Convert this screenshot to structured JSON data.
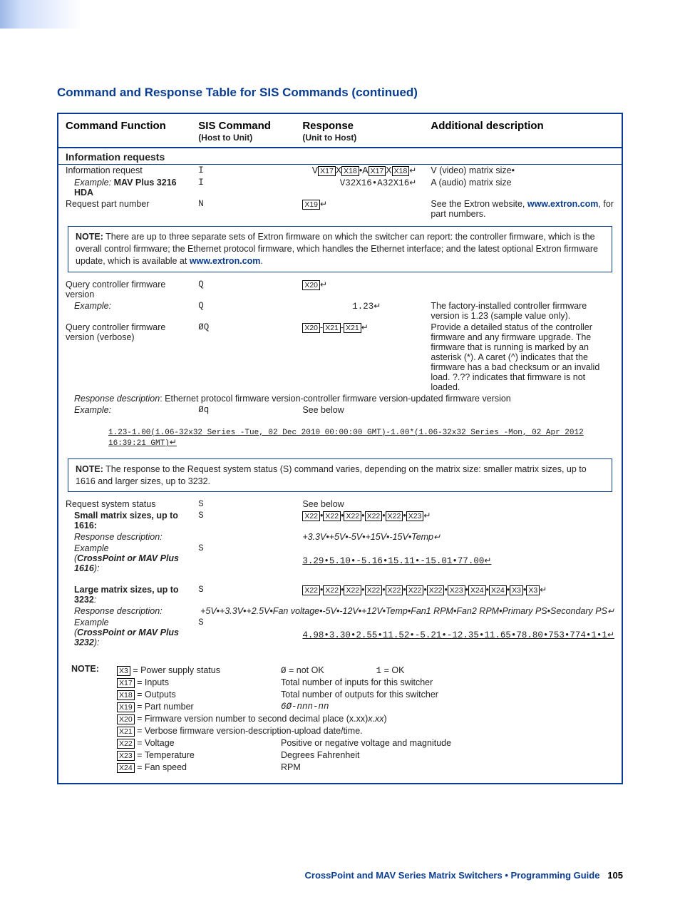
{
  "title": "Command and Response Table for SIS Commands (continued)",
  "headers": {
    "c1": "Command Function",
    "c2": "SIS Command",
    "c2s": "(Host to Unit)",
    "c3": "Response",
    "c3s": "(Unit to Host)",
    "c4": "Additional description"
  },
  "section1": "Information requests",
  "rows": {
    "info_req": {
      "fn": "Information request",
      "cmd": "I",
      "desc": "V (video) matrix size•"
    },
    "info_ex_fn": "Example: ",
    "info_ex_fn2": "MAV Plus 3216 HDA",
    "info_ex_cmd": "I",
    "info_ex_resp": "V32X16•A32X16",
    "info_ex_desc": "A (audio) matrix size",
    "part_req": {
      "fn": "Request part number",
      "cmd": "N",
      "desc1": "See the Extron website, ",
      "link": "www.extron.com",
      "desc2": ", for part numbers."
    }
  },
  "note1_label": "NOTE:",
  "note1_text_a": " There are up to three separate sets of Extron firmware on which the switcher can report: the controller firmware, which is the overall control firmware; the Ethernet protocol firmware, which handles the Ethernet interface; and the latest optional Extron firmware update, which is available at ",
  "note1_link": "www.extron.com",
  "note1_text_b": ".",
  "qfw": {
    "fn": "Query controller firmware version",
    "cmd": "Q"
  },
  "qfw_ex": {
    "fn": "Example:",
    "cmd": "Q",
    "resp": "1.23",
    "desc": "The factory-installed controller firmware version is 1.23 (sample value only)."
  },
  "qfwv": {
    "fn": "Query controller firmware version (verbose)",
    "cmd": "ØQ",
    "desc": "Provide a detailed status of the controller firmware and any firmware upgrade. The firmware that is running is marked by an asterisk (*). A caret (^) indicates that the firmware has a bad checksum or an invalid load. ?.?? indicates that firmware is not loaded."
  },
  "resp_desc_line": "Response description",
  "resp_desc_text": ": Ethernet protocol firmware version-controller firmware version-updated firmware version",
  "qfwv_ex": {
    "fn": "Example:",
    "cmd": "Øq",
    "resp": "See below"
  },
  "long_resp": "1.23-1.00(1.06-32x32 Series -Tue, 02 Dec 2010 00:00:00 GMT)-1.00*(1.06-32x32 Series -Mon, 02 Apr 2012 16:39:21 GMT)",
  "note2_label": "NOTE:",
  "note2_text": " The response to the Request system status (S) command varies, depending on the matrix size: smaller matrix sizes, up to 1616 and larger sizes, up to 3232.",
  "rss": {
    "fn": "Request system status",
    "cmd": "S",
    "resp": "See below"
  },
  "small": {
    "fn": "Small matrix sizes, up to 1616:",
    "cmd": "S"
  },
  "small_rd": {
    "fn": "Response description:",
    "resp": "+3.3V•+5V•-5V•+15V•-15V•Temp"
  },
  "small_ex": {
    "fn1": "Example",
    "fn2": "(",
    "fn3": "CrossPoint or MAV Plus 1616",
    "fn4": "):",
    "cmd": "S",
    "resp": "3.29•5.10•-5.16•15.11•-15.01•77.00"
  },
  "large": {
    "fn": "Large matrix sizes, up to 3232",
    "fn_colon": ":",
    "cmd": "S"
  },
  "large_rd": {
    "fn": "Response description:",
    "resp": "+5V•+3.3V•+2.5V•Fan voltage•-5V•-12V•+12V•Temp•Fan1 RPM•Fan2 RPM•Primary PS•Secondary PS"
  },
  "large_ex": {
    "fn1": "Example",
    "fn2": "(",
    "fn3": "CrossPoint or MAV Plus 3232",
    "fn4": "):",
    "cmd": "S",
    "resp": "4.98•3.30•2.55•11.52•-5.21•-12.35•11.65•78.80•753•774•1•1"
  },
  "glossary_label": "NOTE:",
  "glossary": [
    {
      "k": "X3",
      "d": " = Power supply status",
      "v1": "Ø",
      " v1t": " = not OK",
      "v2": "1",
      "v2t": " = OK"
    },
    {
      "k": "X17",
      "d": " = Inputs",
      "v": "Total number of inputs for this switcher"
    },
    {
      "k": "X18",
      "d": " = Outputs",
      "v": "Total number of outputs for this switcher"
    },
    {
      "k": "X19",
      "d": " = Part number",
      "v": "6Ø-nnn-nn"
    },
    {
      "k": "X20",
      "d": " = Firmware version number to second decimal place (x.xx)"
    },
    {
      "k": "X21",
      "d": " = Verbose firmware version-description-upload date/time."
    },
    {
      "k": "X22",
      "d": " = Voltage",
      "v": "Positive or negative voltage and magnitude"
    },
    {
      "k": "X23",
      "d": " = Temperature",
      "v": "Degrees Fahrenheit"
    },
    {
      "k": "X24",
      "d": " = Fan speed",
      "v": "RPM"
    }
  ],
  "footer": {
    "text": "CrossPoint and MAV Series Matrix Switchers • Programming Guide",
    "page": "105"
  }
}
